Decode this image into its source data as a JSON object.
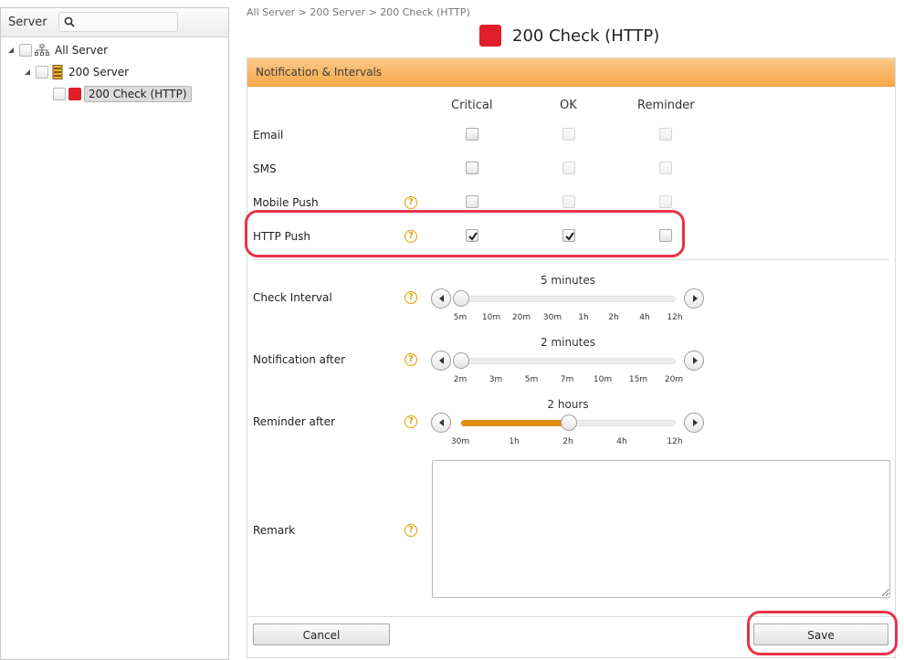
{
  "sidebar": {
    "title": "Server",
    "search_placeholder": "",
    "tree": {
      "root": "All Server",
      "server": "200 Server",
      "check": "200 Check (HTTP)"
    }
  },
  "breadcrumb": "All Server > 200 Server > 200 Check (HTTP)",
  "page_title": "200 Check (HTTP)",
  "status_color": "#e01f2b",
  "panel": {
    "header": "Notification & Intervals",
    "columns": [
      "Critical",
      "OK",
      "Reminder"
    ],
    "rows": [
      {
        "label": "Email",
        "critical": false,
        "ok": false,
        "reminder": false,
        "ok_disabled": true,
        "reminder_disabled": true,
        "help": false
      },
      {
        "label": "SMS",
        "critical": false,
        "ok": false,
        "reminder": false,
        "ok_disabled": true,
        "reminder_disabled": true,
        "help": false
      },
      {
        "label": "Mobile Push",
        "critical": false,
        "ok": false,
        "reminder": false,
        "ok_disabled": true,
        "reminder_disabled": true,
        "help": true
      },
      {
        "label": "HTTP Push",
        "critical": true,
        "ok": true,
        "reminder": false,
        "ok_disabled": false,
        "reminder_disabled": false,
        "help": true
      }
    ],
    "sliders": [
      {
        "label": "Check Interval",
        "value_text": "5 minutes",
        "ticks": [
          "5m",
          "10m",
          "20m",
          "30m",
          "1h",
          "2h",
          "4h",
          "12h"
        ],
        "position": 0
      },
      {
        "label": "Notification after",
        "value_text": "2 minutes",
        "ticks": [
          "2m",
          "3m",
          "5m",
          "7m",
          "10m",
          "15m",
          "20m"
        ],
        "position": 0
      },
      {
        "label": "Reminder after",
        "value_text": "2 hours",
        "ticks": [
          "30m",
          "1h",
          "2h",
          "4h",
          "12h"
        ],
        "position": 0.5
      }
    ],
    "remark_label": "Remark",
    "remark_value": "",
    "cancel_label": "Cancel",
    "save_label": "Save"
  },
  "help_glyph": "?",
  "colors": {
    "accent": "#f5a849",
    "highlight": "#e8334a",
    "slider_fill": "#e08e0b"
  }
}
